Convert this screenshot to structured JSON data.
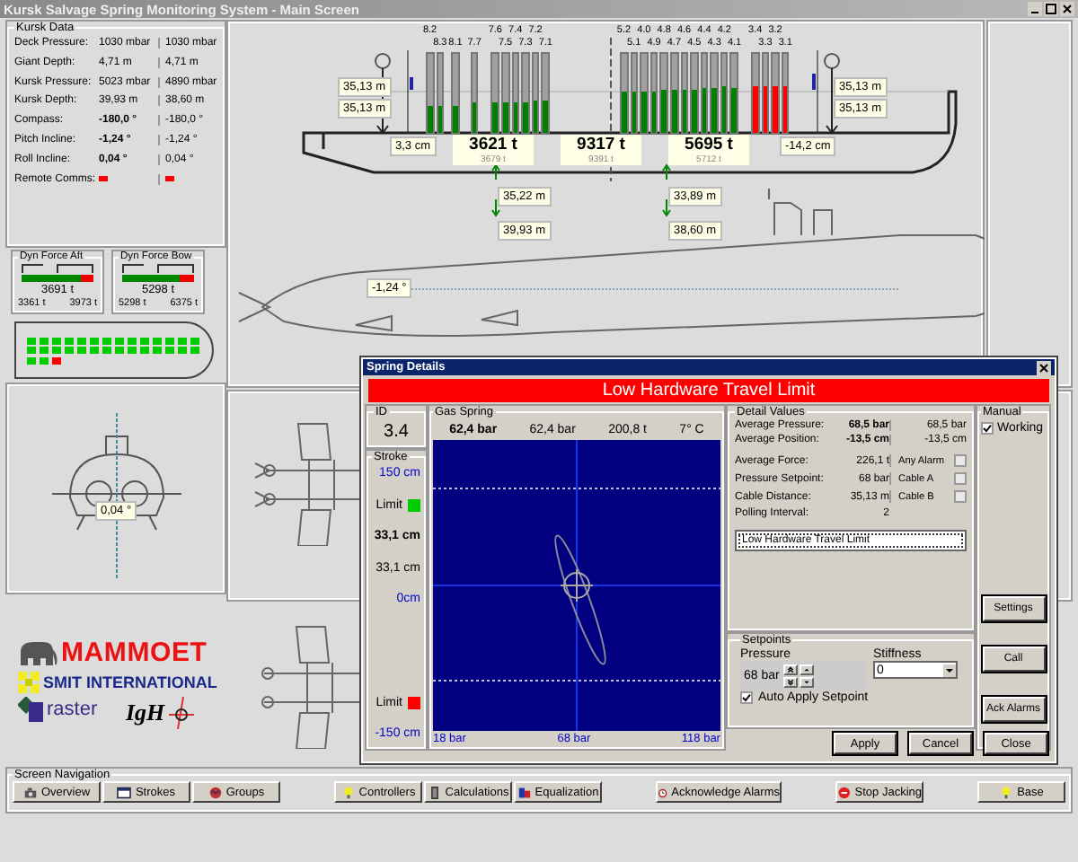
{
  "window": {
    "title": "Kursk Salvage Spring Monitoring System - Main Screen"
  },
  "kursk_data": {
    "title": "Kursk Data",
    "rows": [
      {
        "kind": "value",
        "label": "Deck Pressure:",
        "value": "1030 mbar",
        "value_2": "1030 mbar",
        "bold": false
      },
      {
        "kind": "value",
        "label": "Giant Depth:",
        "value": "4,71 m",
        "value_2": "4,71 m",
        "bold": false
      },
      {
        "kind": "value",
        "label": "Kursk Pressure:",
        "value": "5023 mbar",
        "value_2": "4890 mbar",
        "bold": false
      },
      {
        "kind": "value",
        "label": "Kursk Depth:",
        "value": "39,93 m",
        "value_2": "38,60 m",
        "bold": false
      },
      {
        "kind": "value",
        "label": "Compass:",
        "value": "-180,0 °",
        "value_2": "-180,0 °",
        "bold": true
      },
      {
        "kind": "value",
        "label": "Pitch Incline:",
        "value": "-1,24 °",
        "value_2": "-1,24 °",
        "bold": true
      },
      {
        "kind": "value",
        "label": "Roll Incline:",
        "value": "0,04 °",
        "value_2": "0,04 °",
        "bold": true
      },
      {
        "kind": "indicator",
        "label": "Remote Comms:",
        "alarm": true,
        "alarm_2": true
      }
    ]
  },
  "dyn_force": [
    {
      "title": "Dyn Force Aft",
      "level": 0.82,
      "value": "3691 t",
      "min": "3361 t",
      "max": "3973 t"
    },
    {
      "title": "Dyn Force Bow",
      "level": 0.8,
      "value": "5298 t",
      "min": "5298 t",
      "max": "6375 t"
    }
  ],
  "hull_cells": [
    {
      "alarm": false
    },
    {
      "alarm": false
    },
    {
      "alarm": false
    },
    {
      "alarm": false
    },
    {
      "alarm": false
    },
    {
      "alarm": false
    },
    {
      "alarm": false
    },
    {
      "alarm": false
    },
    {
      "alarm": false
    },
    {
      "alarm": false
    },
    {
      "alarm": false
    },
    {
      "alarm": false
    },
    {
      "alarm": false
    },
    {
      "alarm": false
    },
    {
      "alarm": false
    },
    {
      "alarm": false
    },
    {
      "alarm": false
    },
    {
      "alarm": false
    },
    {
      "alarm": false
    },
    {
      "alarm": false
    },
    {
      "alarm": false
    },
    {
      "alarm": false
    },
    {
      "alarm": false
    },
    {
      "alarm": false
    },
    {
      "alarm": false
    },
    {
      "alarm": false
    },
    {
      "alarm": false
    },
    {
      "alarm": false
    },
    {
      "alarm": false
    },
    {
      "alarm": false
    },
    {
      "alarm": true
    }
  ],
  "roll_view": {
    "reading": "0,04 °"
  },
  "logos": [
    {
      "kind": "mammoet",
      "text": "MAMMOET"
    },
    {
      "kind": "smit",
      "text": "SMIT INTERNATIONAL"
    },
    {
      "kind": "raster",
      "text": "raster"
    },
    {
      "kind": "igh",
      "text": "IgH"
    }
  ],
  "barge": {
    "spring_groups": [
      {
        "springs": [
          {
            "label": "8.2",
            "level": 0.35,
            "alarm": false
          },
          {
            "label": "8.3",
            "level": 0.35,
            "alarm": false
          }
        ]
      },
      {
        "springs": [
          {
            "label": "8.1",
            "level": 0.35,
            "alarm": false
          }
        ]
      },
      {
        "springs": [
          {
            "label": "7.7",
            "level": 0.38,
            "alarm": false
          }
        ]
      },
      {
        "springs": [
          {
            "label": "7.6",
            "level": 0.38,
            "alarm": false
          },
          {
            "label": "7.5",
            "level": 0.38,
            "alarm": false
          },
          {
            "label": "7.4",
            "level": 0.39,
            "alarm": false
          },
          {
            "label": "7.3",
            "level": 0.39,
            "alarm": false
          },
          {
            "label": "7.2",
            "level": 0.4,
            "alarm": false
          },
          {
            "label": "7.1",
            "level": 0.4,
            "alarm": false
          }
        ]
      },
      {
        "springs": [
          {
            "label": "5.2",
            "level": 0.52,
            "alarm": false
          },
          {
            "label": "5.1",
            "level": 0.52,
            "alarm": false
          },
          {
            "label": "4.0",
            "level": 0.53,
            "alarm": false
          },
          {
            "label": "4.9",
            "level": 0.53,
            "alarm": false
          },
          {
            "label": "4.8",
            "level": 0.54,
            "alarm": false
          },
          {
            "label": "4.7",
            "level": 0.54,
            "alarm": false
          },
          {
            "label": "4.6",
            "level": 0.55,
            "alarm": false
          },
          {
            "label": "4.5",
            "level": 0.55,
            "alarm": false
          },
          {
            "label": "4.4",
            "level": 0.56,
            "alarm": false
          },
          {
            "label": "4.3",
            "level": 0.56,
            "alarm": false
          },
          {
            "label": "4.2",
            "level": 0.58,
            "alarm": false
          },
          {
            "label": "4.1",
            "level": 0.57,
            "alarm": false
          }
        ]
      },
      {
        "springs": [
          {
            "label": "3.4",
            "level": 0.6,
            "alarm": true
          },
          {
            "label": "3.3",
            "level": 0.6,
            "alarm": true
          },
          {
            "label": "3.2",
            "level": 0.6,
            "alarm": true
          },
          {
            "label": "3.1",
            "level": 0.6,
            "alarm": true
          }
        ]
      }
    ],
    "cable_left": [
      "35,13 m",
      "35,13 m"
    ],
    "cable_right": [
      "35,13 m",
      "35,13 m"
    ],
    "offset_left": "3,3 cm",
    "offset_right": "-14,2 cm",
    "loads": [
      {
        "value": "3621 t",
        "target": "3679 t"
      },
      {
        "value": "9317 t",
        "target": "9391 t"
      },
      {
        "value": "5695 t",
        "target": "5712 t"
      }
    ],
    "depths": [
      {
        "upper": "35,22 m",
        "lower": "39,93 m"
      },
      {
        "upper": "33,89 m",
        "lower": "38,60 m"
      }
    ]
  },
  "submarine": {
    "pitch": "-1,24 °"
  },
  "spring_details": {
    "title": "Spring Details",
    "alarm_banner": "Low Hardware Travel Limit",
    "id_title": "ID",
    "id": "3.4",
    "stroke_title": "Stroke",
    "stroke_max": "150 cm",
    "limit_top": {
      "label": "Limit",
      "alarm": false
    },
    "stroke_value": "33,1 cm",
    "stroke_value_2": "33,1 cm",
    "stroke_zero": "0cm",
    "limit_bottom": {
      "label": "Limit",
      "alarm": true
    },
    "stroke_min": "-150 cm",
    "gas_spring_title": "Gas Spring",
    "gas_spring": [
      "62,4 bar",
      "62,4 bar",
      "200,8 t",
      "7° C"
    ],
    "plot_x_labels": [
      "18 bar",
      "68 bar",
      "118 bar"
    ],
    "detail_title": "Detail Values",
    "averages": [
      {
        "label": "Average Pressure:",
        "value": "68,5 bar",
        "value_2": "68,5 bar"
      },
      {
        "label": "Average Position:",
        "value": "-13,5 cm",
        "value_2": "-13,5 cm"
      }
    ],
    "details": [
      {
        "label": "Average Force:",
        "value": "226,1 t"
      },
      {
        "label": "Pressure Setpoint:",
        "value": "68 bar"
      },
      {
        "label": "Cable Distance:",
        "value": "35,13 m"
      },
      {
        "label": "Polling Interval:",
        "value": "2"
      }
    ],
    "alarms": [
      {
        "label": "Any Alarm",
        "checked": false
      },
      {
        "label": "Cable A",
        "checked": false
      },
      {
        "label": "Cable B",
        "checked": false
      }
    ],
    "messages": [
      "Low Hardware Travel Limit"
    ],
    "setpoints_title": "Setpoints",
    "pressure_title": "Pressure",
    "pressure": "68 bar",
    "stiffness_title": "Stiffness",
    "stiffness": "0",
    "auto_apply": {
      "label": "Auto Apply Setpoint",
      "checked": true
    },
    "manual_title": "Manual",
    "working": {
      "label": "Working",
      "checked": true
    },
    "side_buttons": [
      "Settings",
      "Call",
      "Ack Alarms"
    ],
    "footer_buttons": [
      "Apply",
      "Cancel",
      "Close"
    ]
  },
  "navigation": {
    "title": "Screen Navigation",
    "groups": [
      [
        {
          "kind": "camera",
          "label": "Overview"
        },
        {
          "kind": "window",
          "label": "Strokes"
        },
        {
          "kind": "globe",
          "label": "Groups"
        }
      ],
      [
        {
          "kind": "bulb",
          "label": "Controllers"
        },
        {
          "kind": "canister",
          "label": "Calculations"
        },
        {
          "kind": "blocks",
          "label": "Equalization"
        }
      ],
      [
        {
          "kind": "clock",
          "label": "Acknowledge Alarms"
        }
      ],
      [
        {
          "kind": "stop",
          "label": "Stop Jacking"
        }
      ],
      [
        {
          "kind": "bulb",
          "label": "Base"
        }
      ]
    ]
  }
}
